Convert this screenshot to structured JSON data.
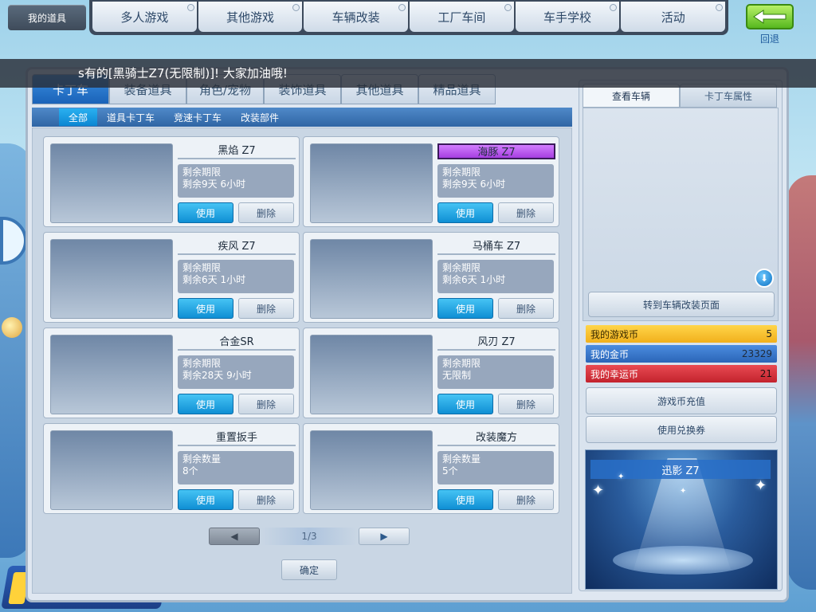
{
  "top_tab": {
    "label": "我的道具"
  },
  "nav": {
    "items": [
      "多人游戏",
      "其他游戏",
      "车辆改装",
      "工厂车间",
      "车手学校",
      "活动"
    ]
  },
  "back": {
    "label": "回退"
  },
  "broadcast": {
    "text": "s有的[黑骑士Z7(无限制)]! 大家加油哦!"
  },
  "categories": [
    "卡丁车",
    "装备道具",
    "角色/宠物",
    "装饰道具",
    "其他道具",
    "精品道具"
  ],
  "sub_tabs": [
    "全部",
    "道具卡丁车",
    "竞速卡丁车",
    "改装部件"
  ],
  "items": [
    {
      "name": "黑焰 Z7",
      "line1": "剩余期限",
      "line2": "剩余9天 6小时"
    },
    {
      "name": "海豚 Z7",
      "line1": "剩余期限",
      "line2": "剩余9天 6小时"
    },
    {
      "name": "疾风 Z7",
      "line1": "剩余期限",
      "line2": "剩余6天 1小时"
    },
    {
      "name": "马桶车 Z7",
      "line1": "剩余期限",
      "line2": "剩余6天 1小时"
    },
    {
      "name": "合金SR",
      "line1": "剩余期限",
      "line2": "剩余28天 9小时"
    },
    {
      "name": "风刃 Z7",
      "line1": "剩余期限",
      "line2": "无限制"
    },
    {
      "name": "重置扳手",
      "line1": "剩余数量",
      "line2": "8个"
    },
    {
      "name": "改装魔方",
      "line1": "剩余数量",
      "line2": "5个"
    }
  ],
  "buttons": {
    "use": "使用",
    "delete": "删除",
    "confirm": "确定",
    "prev": "◀",
    "next": "▶"
  },
  "pager": {
    "text": "1/3"
  },
  "side": {
    "tabs": [
      "查看车辆",
      "卡丁车属性"
    ],
    "goto_mod": "转到车辆改装页面",
    "download_icon": "⬇",
    "currencies": [
      {
        "label": "我的游戏币",
        "value": "5"
      },
      {
        "label": "我的金币",
        "value": "23329"
      },
      {
        "label": "我的幸运币",
        "value": "21"
      }
    ],
    "recharge": "游戏币充值",
    "voucher": "使用兑换券",
    "showcase_title": "迅影 Z7"
  },
  "colors": {
    "accent": "#1a62b8",
    "use_button": "#0f8fd4",
    "highlight_name": "#a63fe0",
    "back_green": "#57b81f"
  }
}
